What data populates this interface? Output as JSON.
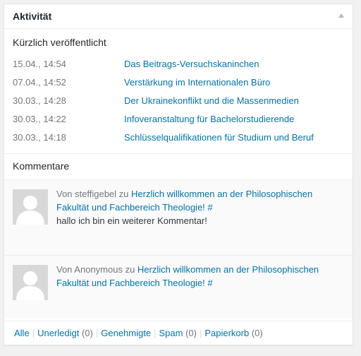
{
  "widget": {
    "title": "Aktivität",
    "toggle_icon": "triangle-up-icon"
  },
  "recent": {
    "heading": "Kürzlich veröffentlicht",
    "items": [
      {
        "date": "15.04., 14:54",
        "title": "Das Beitrags-Versuchskaninchen"
      },
      {
        "date": "07.04., 14:52",
        "title": "Verstärkung im Internationalen Büro"
      },
      {
        "date": "30.03., 14:28",
        "title": "Der Ukrainekonflikt und die Massenmedien"
      },
      {
        "date": "30.03., 14:22",
        "title": "Infoveranstaltung für Bachelorstudierende"
      },
      {
        "date": "30.03., 14:18",
        "title": "Schlüsselqualifikationen für Studium und Beruf"
      }
    ]
  },
  "comments": {
    "heading": "Kommentare",
    "items": [
      {
        "author_prefix": "Von steffigebel zu ",
        "post_title": "Herzlich willkommen an der Philosophischen Fakultät und Fachbereich Theologie!",
        "permalink": "#",
        "body": "hallo ich bin ein weiterer Kommentar!"
      },
      {
        "author_prefix": "Von Anonymous zu ",
        "post_title": "Herzlich willkommen an der Philosophischen Fakultät und Fachbereich Theologie!",
        "permalink": "#",
        "body": ""
      }
    ]
  },
  "filters": [
    {
      "label": "Alle",
      "count": ""
    },
    {
      "label": "Unerledigt",
      "count": "(0)"
    },
    {
      "label": "Genehmigte",
      "count": ""
    },
    {
      "label": "Spam",
      "count": "(0)"
    },
    {
      "label": "Papierkorb",
      "count": "(0)"
    }
  ],
  "colors": {
    "link": "#0073aa",
    "muted": "#72777c",
    "avatar_bg": "#d8d8d8"
  }
}
